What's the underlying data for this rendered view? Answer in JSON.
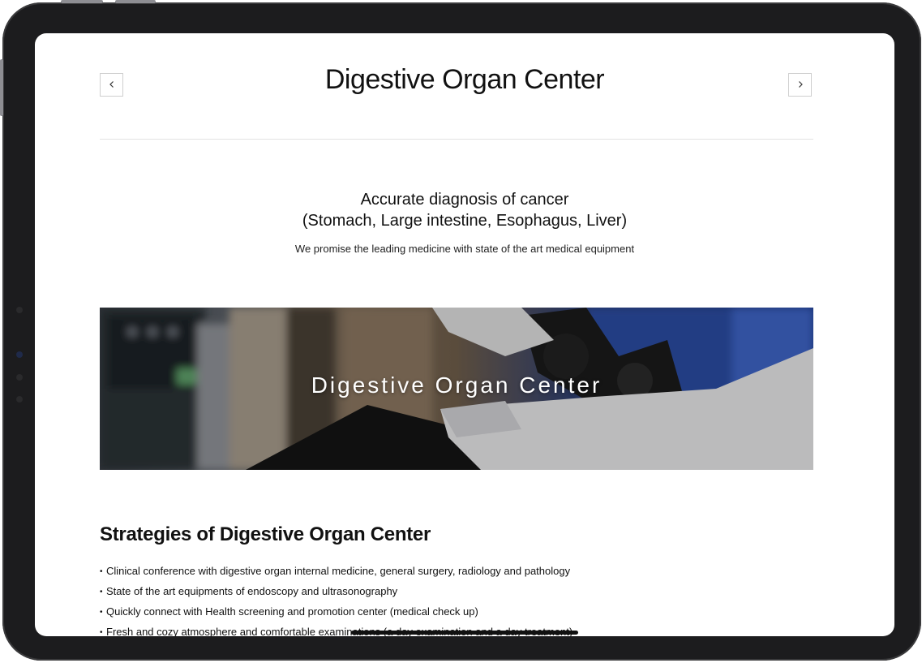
{
  "header": {
    "title": "Digestive Organ Center",
    "prev_icon": "chevron-left-icon",
    "next_icon": "chevron-right-icon"
  },
  "intro": {
    "heading_line1": "Accurate diagnosis of cancer",
    "heading_line2": "(Stomach, Large intestine, Esophagus, Liver)",
    "subtext": "We promise the leading medicine with state of the art medical equipment"
  },
  "banner": {
    "title": "Digestive Organ Center",
    "image": "endoscope-photo"
  },
  "strategies": {
    "heading": "Strategies of Digestive Organ Center",
    "items": [
      "Clinical conference with digestive organ internal medicine, general surgery, radiology and pathology",
      "State of the art equipments of endoscopy and ultrasonography",
      "Quickly connect with Health screening and promotion center (medical check up)",
      "Fresh and cozy atmosphere and comfortable examinations (a day examination and a day treatment)"
    ]
  },
  "colors": {
    "device_frame": "#1c1c1e",
    "text": "#111111",
    "divider": "#e3e3e3"
  }
}
